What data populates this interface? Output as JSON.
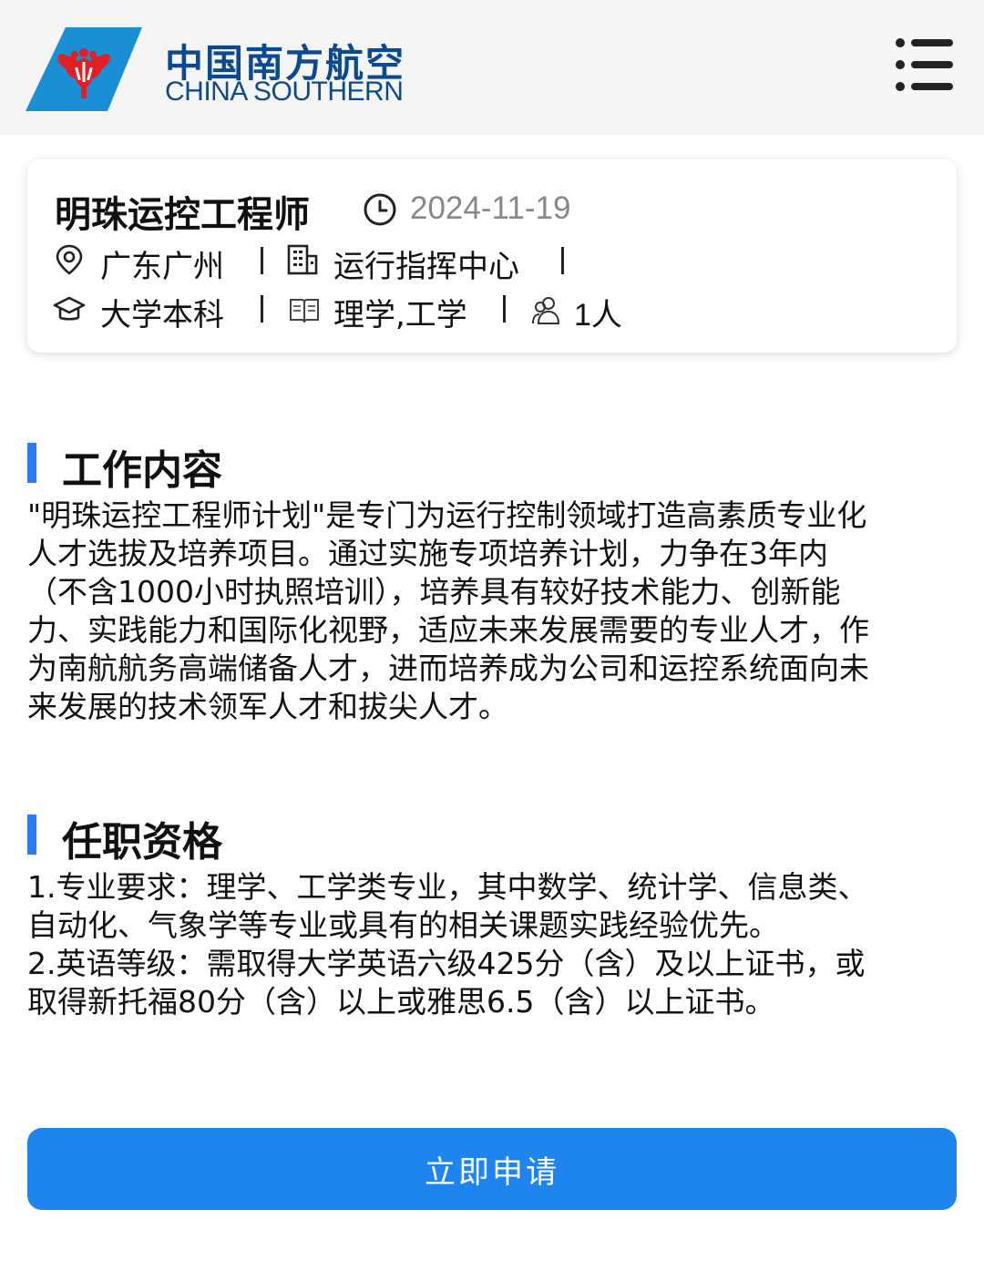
{
  "header": {
    "logo_cn": "中国南方航空",
    "logo_en": "CHINA SOUTHERN",
    "menu_icon": "menu-list-icon",
    "logo_colors": {
      "sky": "#1a8fd4",
      "flower": "#e02024"
    }
  },
  "job": {
    "title": "明珠运控工程师",
    "date": "2024-11-19",
    "location": "广东广州",
    "department": "运行指挥中心",
    "education": "大学本科",
    "majors": "理学,工学",
    "headcount": "1人"
  },
  "sections": {
    "duties": {
      "title": "工作内容",
      "lines": [
        "\"明珠运控工程师计划\"是专门为运行控制领域打造高素质专业化",
        "人才选拔及培养项目。通过实施专项培养计划，力争在3年内",
        "（不含1000小时执照培训），培养具有较好技术能力、创新能",
        "力、实践能力和国际化视野，适应未来发展需要的专业人才，作",
        "为南航航务高端储备人才，进而培养成为公司和运控系统面向未",
        "来发展的技术领军人才和拔尖人才。"
      ]
    },
    "qualifications": {
      "title": "任职资格",
      "lines": [
        "1.专业要求：理学、工学类专业，其中数学、统计学、信息类、",
        "自动化、气象学等专业或具有的相关课题实践经验优先。",
        "2.英语等级：需取得大学英语六级425分（含）及以上证书，或",
        "取得新托福80分（含）以上或雅思6.5（含）以上证书。"
      ]
    }
  },
  "apply_button": {
    "label": "立即申请",
    "color": "#1f85ee"
  },
  "accent_color": "#2f7bf0"
}
